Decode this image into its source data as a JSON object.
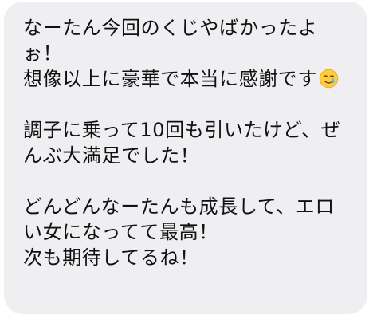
{
  "message": {
    "paragraphs": [
      {
        "lines": [
          "なーたん今回のくじやばかったよ",
          "ぉ！",
          "想像以上に豪華で本当に感謝です"
        ],
        "trailing_icon": "smiling-face-with-tear-icon"
      },
      {
        "lines": [
          "調子に乗って10回も引いたけど、ぜ",
          "んぶ大満足でした！"
        ]
      },
      {
        "lines": [
          "どんどんなーたんも成長して、エロ",
          "い女になってて最高！",
          "次も期待してるね！"
        ]
      }
    ]
  },
  "colors": {
    "bubble_background": "#efeff2",
    "text": "#111111",
    "page_background": "#ffffff"
  }
}
